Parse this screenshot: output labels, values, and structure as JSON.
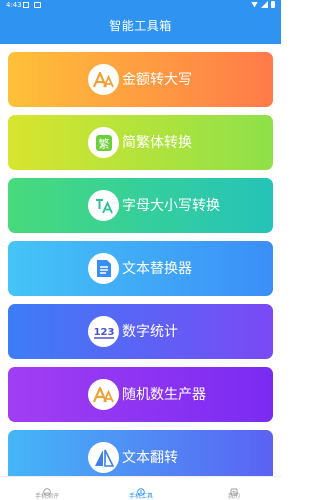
{
  "status": {
    "time": "4:43"
  },
  "header": {
    "title": "智能工具箱"
  },
  "tools": [
    {
      "label": "金额转大写",
      "icon": "font-aa-icon"
    },
    {
      "label": "简繁体转换",
      "icon": "traditional-char-icon"
    },
    {
      "label": "字母大小写转换",
      "icon": "translate-letters-icon"
    },
    {
      "label": "文本替换器",
      "icon": "document-icon"
    },
    {
      "label": "数字统计",
      "icon": "numbers-123-icon"
    },
    {
      "label": "随机数生产器",
      "icon": "font-aa-icon"
    },
    {
      "label": "文本翻转",
      "icon": "flip-icon"
    }
  ],
  "tabs": [
    {
      "label": "手机测评",
      "icon": "smile-icon"
    },
    {
      "label": "手机工具",
      "icon": "tool-icon"
    },
    {
      "label": "我的",
      "icon": "profile-icon"
    }
  ],
  "colors": {
    "primary": "#2f94f1",
    "card_gradients": [
      [
        "#fdc139",
        "#ff7a4a"
      ],
      [
        "#d8e52f",
        "#8fe04a"
      ],
      [
        "#48da7b",
        "#25c3b9"
      ],
      [
        "#45c5f6",
        "#3b8ef7"
      ],
      [
        "#3d7df6",
        "#7a49f5"
      ],
      [
        "#a13ef3",
        "#7a2bf1"
      ],
      [
        "#45b6f6",
        "#5b62f3"
      ]
    ]
  }
}
